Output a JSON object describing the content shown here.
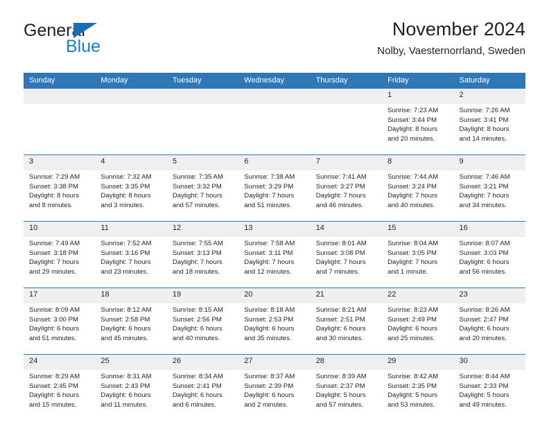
{
  "logo": {
    "word_top": "General",
    "word_bottom": "Blue",
    "triangle_color": "#1a6eb5",
    "blue_color": "#1b7ec4"
  },
  "header": {
    "title": "November 2024",
    "subtitle": "Nolby, Vaesternorrland, Sweden"
  },
  "theme": {
    "header_blue": "#3077b8",
    "daynum_gray": "#efefef",
    "text_color": "#231f20"
  },
  "calendar": {
    "weekday_headers": [
      "Sunday",
      "Monday",
      "Tuesday",
      "Wednesday",
      "Thursday",
      "Friday",
      "Saturday"
    ],
    "weeks": [
      [
        {
          "day": "",
          "lines": []
        },
        {
          "day": "",
          "lines": []
        },
        {
          "day": "",
          "lines": []
        },
        {
          "day": "",
          "lines": []
        },
        {
          "day": "",
          "lines": []
        },
        {
          "day": "1",
          "lines": [
            "Sunrise: 7:23 AM",
            "Sunset: 3:44 PM",
            "Daylight: 8 hours",
            "and 20 minutes."
          ]
        },
        {
          "day": "2",
          "lines": [
            "Sunrise: 7:26 AM",
            "Sunset: 3:41 PM",
            "Daylight: 8 hours",
            "and 14 minutes."
          ]
        }
      ],
      [
        {
          "day": "3",
          "lines": [
            "Sunrise: 7:29 AM",
            "Sunset: 3:38 PM",
            "Daylight: 8 hours",
            "and 8 minutes."
          ]
        },
        {
          "day": "4",
          "lines": [
            "Sunrise: 7:32 AM",
            "Sunset: 3:35 PM",
            "Daylight: 8 hours",
            "and 3 minutes."
          ]
        },
        {
          "day": "5",
          "lines": [
            "Sunrise: 7:35 AM",
            "Sunset: 3:32 PM",
            "Daylight: 7 hours",
            "and 57 minutes."
          ]
        },
        {
          "day": "6",
          "lines": [
            "Sunrise: 7:38 AM",
            "Sunset: 3:29 PM",
            "Daylight: 7 hours",
            "and 51 minutes."
          ]
        },
        {
          "day": "7",
          "lines": [
            "Sunrise: 7:41 AM",
            "Sunset: 3:27 PM",
            "Daylight: 7 hours",
            "and 46 minutes."
          ]
        },
        {
          "day": "8",
          "lines": [
            "Sunrise: 7:44 AM",
            "Sunset: 3:24 PM",
            "Daylight: 7 hours",
            "and 40 minutes."
          ]
        },
        {
          "day": "9",
          "lines": [
            "Sunrise: 7:46 AM",
            "Sunset: 3:21 PM",
            "Daylight: 7 hours",
            "and 34 minutes."
          ]
        }
      ],
      [
        {
          "day": "10",
          "lines": [
            "Sunrise: 7:49 AM",
            "Sunset: 3:18 PM",
            "Daylight: 7 hours",
            "and 29 minutes."
          ]
        },
        {
          "day": "11",
          "lines": [
            "Sunrise: 7:52 AM",
            "Sunset: 3:16 PM",
            "Daylight: 7 hours",
            "and 23 minutes."
          ]
        },
        {
          "day": "12",
          "lines": [
            "Sunrise: 7:55 AM",
            "Sunset: 3:13 PM",
            "Daylight: 7 hours",
            "and 18 minutes."
          ]
        },
        {
          "day": "13",
          "lines": [
            "Sunrise: 7:58 AM",
            "Sunset: 3:11 PM",
            "Daylight: 7 hours",
            "and 12 minutes."
          ]
        },
        {
          "day": "14",
          "lines": [
            "Sunrise: 8:01 AM",
            "Sunset: 3:08 PM",
            "Daylight: 7 hours",
            "and 7 minutes."
          ]
        },
        {
          "day": "15",
          "lines": [
            "Sunrise: 8:04 AM",
            "Sunset: 3:05 PM",
            "Daylight: 7 hours",
            "and 1 minute."
          ]
        },
        {
          "day": "16",
          "lines": [
            "Sunrise: 8:07 AM",
            "Sunset: 3:03 PM",
            "Daylight: 6 hours",
            "and 56 minutes."
          ]
        }
      ],
      [
        {
          "day": "17",
          "lines": [
            "Sunrise: 8:09 AM",
            "Sunset: 3:00 PM",
            "Daylight: 6 hours",
            "and 51 minutes."
          ]
        },
        {
          "day": "18",
          "lines": [
            "Sunrise: 8:12 AM",
            "Sunset: 2:58 PM",
            "Daylight: 6 hours",
            "and 45 minutes."
          ]
        },
        {
          "day": "19",
          "lines": [
            "Sunrise: 8:15 AM",
            "Sunset: 2:56 PM",
            "Daylight: 6 hours",
            "and 40 minutes."
          ]
        },
        {
          "day": "20",
          "lines": [
            "Sunrise: 8:18 AM",
            "Sunset: 2:53 PM",
            "Daylight: 6 hours",
            "and 35 minutes."
          ]
        },
        {
          "day": "21",
          "lines": [
            "Sunrise: 8:21 AM",
            "Sunset: 2:51 PM",
            "Daylight: 6 hours",
            "and 30 minutes."
          ]
        },
        {
          "day": "22",
          "lines": [
            "Sunrise: 8:23 AM",
            "Sunset: 2:49 PM",
            "Daylight: 6 hours",
            "and 25 minutes."
          ]
        },
        {
          "day": "23",
          "lines": [
            "Sunrise: 8:26 AM",
            "Sunset: 2:47 PM",
            "Daylight: 6 hours",
            "and 20 minutes."
          ]
        }
      ],
      [
        {
          "day": "24",
          "lines": [
            "Sunrise: 8:29 AM",
            "Sunset: 2:45 PM",
            "Daylight: 6 hours",
            "and 15 minutes."
          ]
        },
        {
          "day": "25",
          "lines": [
            "Sunrise: 8:31 AM",
            "Sunset: 2:43 PM",
            "Daylight: 6 hours",
            "and 11 minutes."
          ]
        },
        {
          "day": "26",
          "lines": [
            "Sunrise: 8:34 AM",
            "Sunset: 2:41 PM",
            "Daylight: 6 hours",
            "and 6 minutes."
          ]
        },
        {
          "day": "27",
          "lines": [
            "Sunrise: 8:37 AM",
            "Sunset: 2:39 PM",
            "Daylight: 6 hours",
            "and 2 minutes."
          ]
        },
        {
          "day": "28",
          "lines": [
            "Sunrise: 8:39 AM",
            "Sunset: 2:37 PM",
            "Daylight: 5 hours",
            "and 57 minutes."
          ]
        },
        {
          "day": "29",
          "lines": [
            "Sunrise: 8:42 AM",
            "Sunset: 2:35 PM",
            "Daylight: 5 hours",
            "and 53 minutes."
          ]
        },
        {
          "day": "30",
          "lines": [
            "Sunrise: 8:44 AM",
            "Sunset: 2:33 PM",
            "Daylight: 5 hours",
            "and 49 minutes."
          ]
        }
      ]
    ]
  }
}
